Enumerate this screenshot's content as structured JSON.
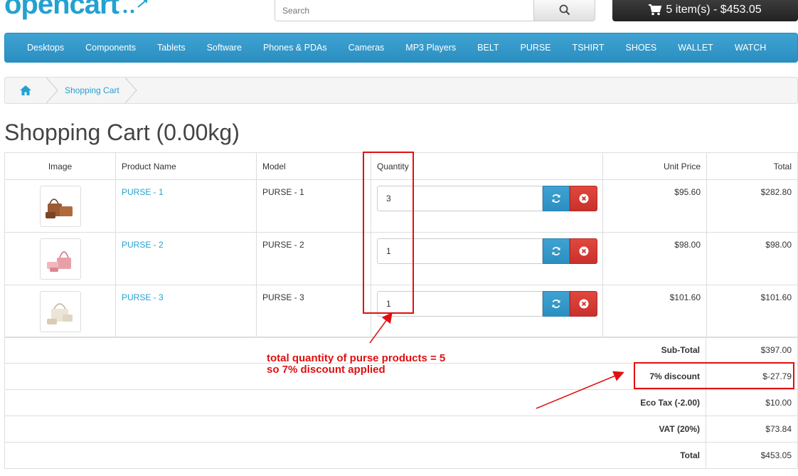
{
  "header": {
    "logo_text": "opencart",
    "search_placeholder": "Search",
    "cart_label": "5 item(s) - $453.05"
  },
  "menu": [
    "Desktops",
    "Components",
    "Tablets",
    "Software",
    "Phones & PDAs",
    "Cameras",
    "MP3 Players",
    "BELT",
    "PURSE",
    "TSHIRT",
    "SHOES",
    "WALLET",
    "WATCH"
  ],
  "breadcrumb": {
    "current": "Shopping Cart"
  },
  "page_title": "Shopping Cart  (0.00kg)",
  "table": {
    "headers": {
      "image": "Image",
      "name": "Product Name",
      "model": "Model",
      "quantity": "Quantity",
      "unit_price": "Unit Price",
      "total": "Total"
    },
    "rows": [
      {
        "name": "PURSE - 1",
        "model": "PURSE - 1",
        "quantity": "3",
        "unit_price": "$95.60",
        "total": "$282.80",
        "color": "#9a5a32"
      },
      {
        "name": "PURSE - 2",
        "model": "PURSE - 2",
        "quantity": "1",
        "unit_price": "$98.00",
        "total": "$98.00",
        "color": "#e8a0a8"
      },
      {
        "name": "PURSE - 3",
        "model": "PURSE - 3",
        "quantity": "1",
        "unit_price": "$101.60",
        "total": "$101.60",
        "color": "#e8e0d0"
      }
    ]
  },
  "totals": [
    {
      "label": "Sub-Total",
      "value": "$397.00"
    },
    {
      "label": "7% discount",
      "value": "$-27.79"
    },
    {
      "label": "Eco Tax (-2.00)",
      "value": "$10.00"
    },
    {
      "label": "VAT (20%)",
      "value": "$73.84"
    },
    {
      "label": "Total",
      "value": "$453.05"
    }
  ],
  "annotation": {
    "line1": "total quantity of purse products = 5",
    "line2": "so 7% discount applied",
    "color": "#e01010"
  },
  "colors": {
    "accent": "#23a1d1",
    "danger": "#c9302c"
  }
}
